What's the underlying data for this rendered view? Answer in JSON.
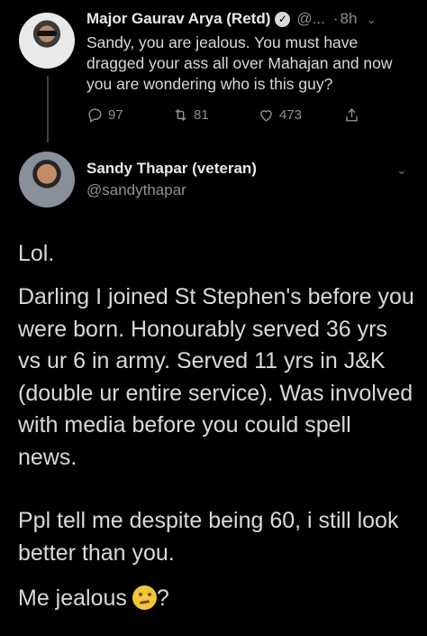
{
  "parent_tweet": {
    "author_name": "Major Gaurav Arya (Retd)",
    "verified_mark": "✓",
    "handle": "@...",
    "dot": "·",
    "time": "8h",
    "text": "Sandy, you are jealous. You must have dragged your ass all over Mahajan and now you are wondering who is this guy?",
    "replies": "97",
    "retweets": "81",
    "likes": "473",
    "icons": [
      "reply-icon",
      "retweet-icon",
      "like-icon",
      "share-icon"
    ]
  },
  "main_tweet": {
    "author_name": "Sandy Thapar (veteran)",
    "handle": "@sandythapar",
    "paragraphs": [
      "Lol.",
      "Darling I joined St Stephen's before you were born. Honourably served 36 yrs vs ur 6 in army. Served 11 yrs in J&K (double ur entire service). Was involved with media before you could spell news.",
      "Ppl tell me despite being 60, i still look better than you.",
      "Me jealous",
      "?"
    ],
    "emoji": "thinking-face"
  },
  "colors": {
    "background": "#000000",
    "text": "#d9d9d9",
    "secondary": "#8b9198",
    "thread_line": "#3a3f45"
  }
}
